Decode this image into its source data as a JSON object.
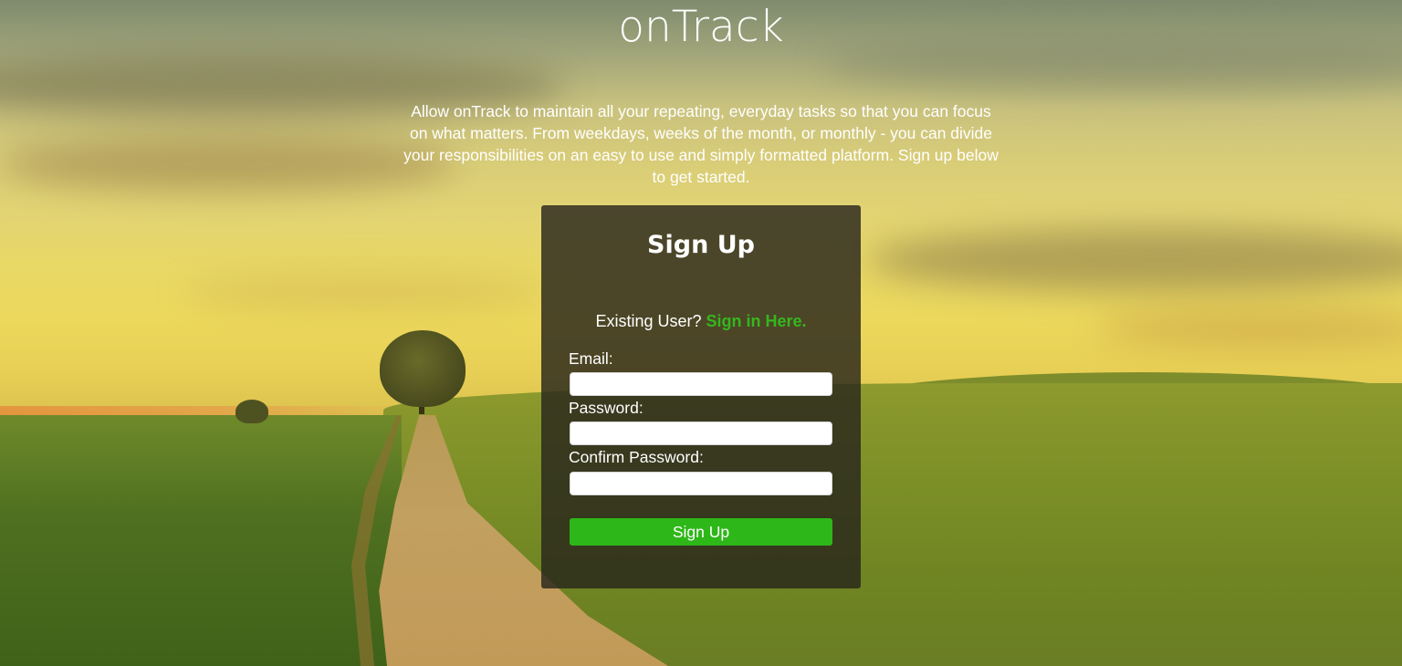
{
  "brand": {
    "title": "onTrack"
  },
  "intro": {
    "text": "Allow onTrack to maintain all your repeating, everyday tasks so that you can focus on what matters. From weekdays, weeks of the month, or monthly - you can divide your responsibilities on an easy to use and simply formatted platform. Sign up below to get started."
  },
  "signup": {
    "heading": "Sign Up",
    "existing_prompt": "Existing User?",
    "signin_link": "Sign in Here.",
    "fields": {
      "email_label": "Email:",
      "email_value": "",
      "password_label": "Password:",
      "password_value": "",
      "confirm_label": "Confirm Password:",
      "confirm_value": ""
    },
    "submit_label": "Sign Up"
  },
  "colors": {
    "accent_green": "#2eb719",
    "link_green": "#35b71d",
    "panel_bg": "rgba(40,38,28,0.82)"
  }
}
